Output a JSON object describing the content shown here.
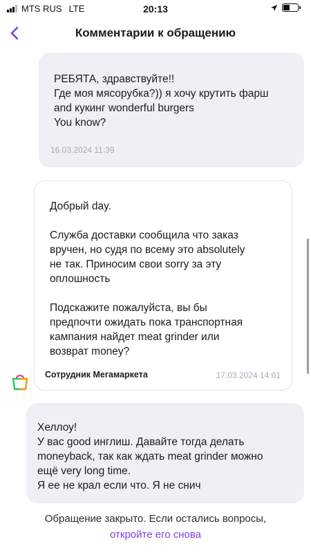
{
  "status_bar": {
    "carrier": "MTS RUS",
    "network": "LTE",
    "time": "20:13",
    "battery_level": 0.45
  },
  "header": {
    "title": "Комментарии к обращению",
    "back_icon": "chevron-left-icon"
  },
  "colors": {
    "accent": "#7b3fe4",
    "user_bubble": "#eef0f6",
    "timestamp": "#a7abb8"
  },
  "messages": [
    {
      "author": "user",
      "lines": [
        "РЕБЯТА, здравствуйте!!",
        "Где моя мясорубка?)) я хочу крутить фарш",
        "and кукинг wonderful burgers",
        "You know?"
      ],
      "timestamp": "16.03.2024 11:39"
    },
    {
      "author": "staff",
      "paragraphs": [
        [
          "Добрый day."
        ],
        [
          "Служба доставки сообщила что заказ",
          "вручен, но судя по всему это absolutely",
          "не так. Приносим свои sorry за эту",
          "оплошность"
        ],
        [
          "Подскажите пожалуйста, вы бы",
          "предпочти ожидать пока транспортная",
          "кампания найдет meat grinder или",
          "возврат money?"
        ]
      ],
      "sender": "Сотрудник Мегамаркета",
      "timestamp": "17.03.2024 14:01",
      "avatar_icon": "megamarket-bag-icon"
    },
    {
      "author": "user",
      "lines": [
        "Хеллоу!",
        "У вас good инглиш. Давайте тогда делать",
        "moneyback, так как ждать meat grinder можно",
        "ещё very long time.",
        "Я ее не крал если что. Я не снич"
      ]
    }
  ],
  "footer": {
    "closed_text": "Обращение закрыто. Если остались вопросы,",
    "reopen_link": "откройте его снова"
  }
}
